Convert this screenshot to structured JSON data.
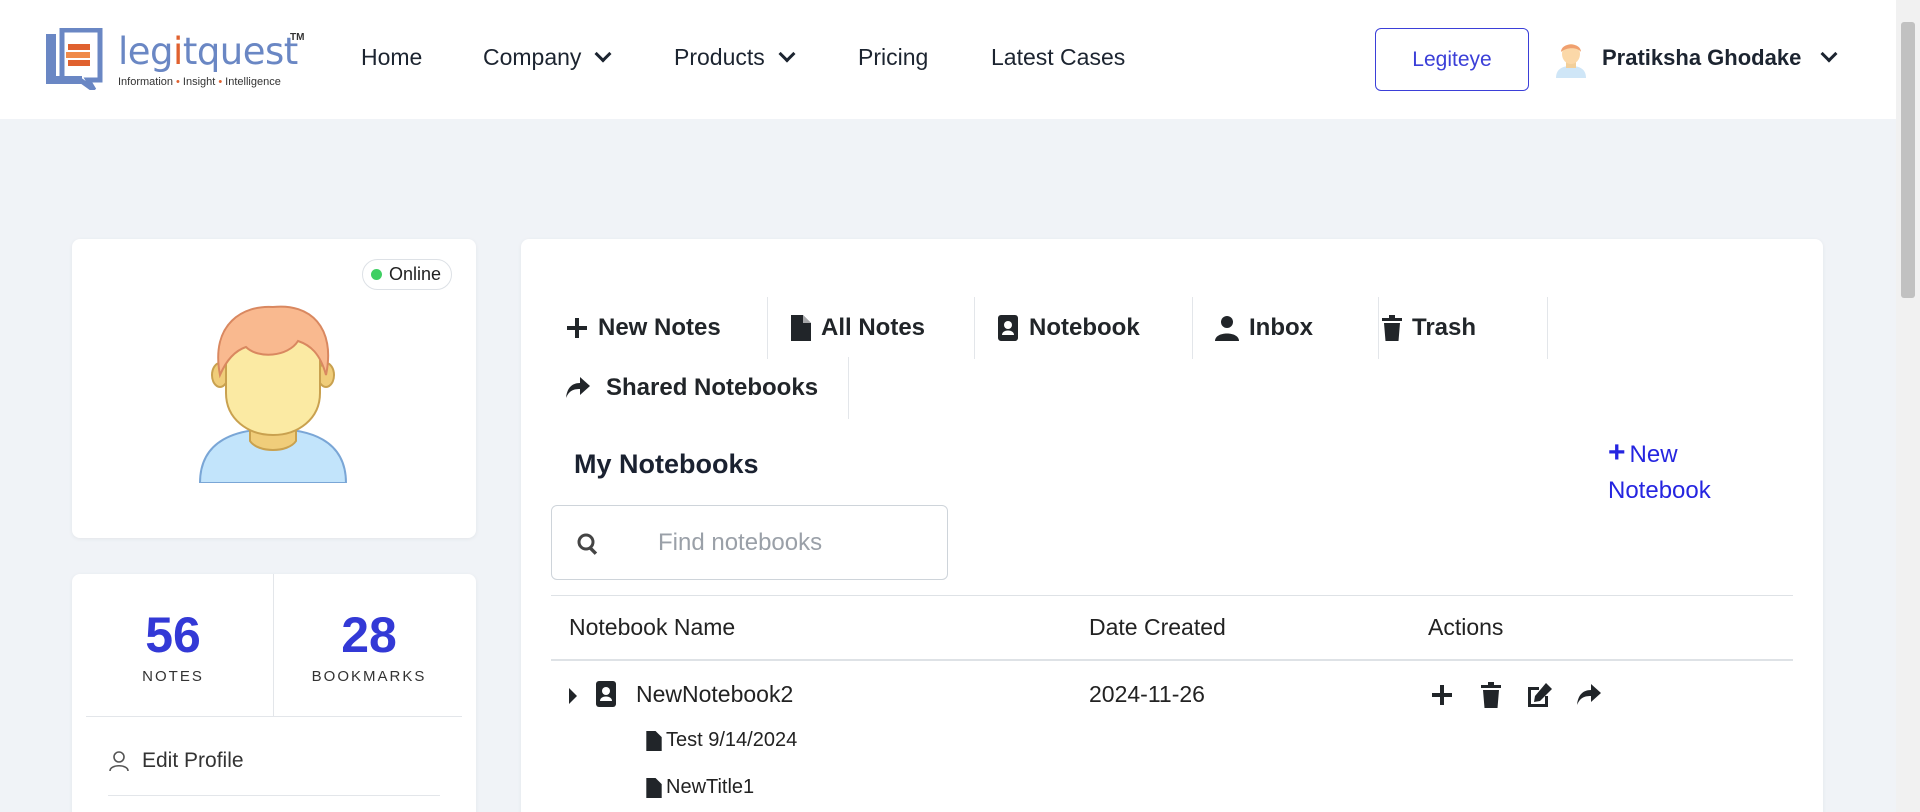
{
  "header": {
    "logo": {
      "word_pre": "leg",
      "word_i": "i",
      "word_post": "tquest",
      "tm": "TM",
      "tag1": "Information",
      "tag2": "Insight",
      "tag3": "Intelligence",
      "tag_sep": "•"
    },
    "nav": [
      {
        "label": "Home",
        "dropdown": false
      },
      {
        "label": "Company",
        "dropdown": true
      },
      {
        "label": "Products",
        "dropdown": true
      },
      {
        "label": "Pricing",
        "dropdown": false
      },
      {
        "label": "Latest Cases",
        "dropdown": false
      }
    ],
    "legiteye_label": "Legiteye",
    "user_name": "Pratiksha Ghodake"
  },
  "profile": {
    "status": "Online",
    "status_color": "#3ecf62"
  },
  "stats": {
    "notes_count": "56",
    "notes_label": "NOTES",
    "bookmarks_count": "28",
    "bookmarks_label": "BOOKMARKS",
    "edit_profile_label": "Edit Profile"
  },
  "tabs": [
    {
      "label": "New Notes",
      "icon": "plus-icon"
    },
    {
      "label": "All Notes",
      "icon": "file-icon"
    },
    {
      "label": "Notebook",
      "icon": "address-book-icon"
    },
    {
      "label": "Inbox",
      "icon": "user-icon"
    },
    {
      "label": "Trash",
      "icon": "trash-icon"
    },
    {
      "label": "Shared Notebooks",
      "icon": "share-icon"
    }
  ],
  "notebooks": {
    "title": "My Notebooks",
    "new_notebook_plus": "+",
    "new_notebook_line1": "New",
    "new_notebook_line2": "Notebook",
    "search_placeholder": "Find notebooks",
    "columns": [
      "Notebook Name",
      "Date Created",
      "Actions"
    ],
    "rows": [
      {
        "name": "NewNotebook2",
        "date": "2024-11-26",
        "notes": [
          "Test 9/14/2024",
          "NewTitle1"
        ]
      }
    ]
  },
  "colors": {
    "accent": "#3339d6",
    "link": "#2525e0",
    "page_bg": "#f0f3f7"
  }
}
